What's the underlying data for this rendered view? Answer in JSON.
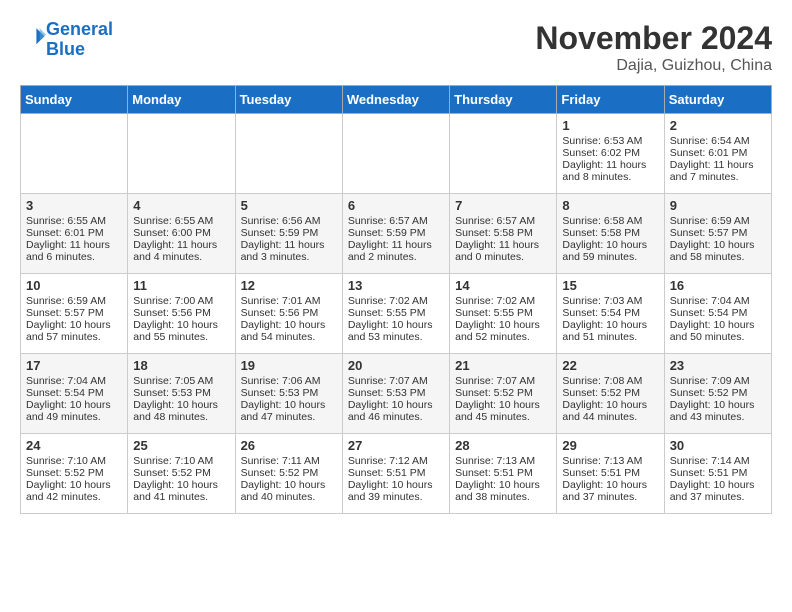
{
  "header": {
    "logo_line1": "General",
    "logo_line2": "Blue",
    "month_title": "November 2024",
    "location": "Dajia, Guizhou, China"
  },
  "days_of_week": [
    "Sunday",
    "Monday",
    "Tuesday",
    "Wednesday",
    "Thursday",
    "Friday",
    "Saturday"
  ],
  "weeks": [
    [
      {
        "day": "",
        "content": ""
      },
      {
        "day": "",
        "content": ""
      },
      {
        "day": "",
        "content": ""
      },
      {
        "day": "",
        "content": ""
      },
      {
        "day": "",
        "content": ""
      },
      {
        "day": "1",
        "content": "Sunrise: 6:53 AM\nSunset: 6:02 PM\nDaylight: 11 hours and 8 minutes."
      },
      {
        "day": "2",
        "content": "Sunrise: 6:54 AM\nSunset: 6:01 PM\nDaylight: 11 hours and 7 minutes."
      }
    ],
    [
      {
        "day": "3",
        "content": "Sunrise: 6:55 AM\nSunset: 6:01 PM\nDaylight: 11 hours and 6 minutes."
      },
      {
        "day": "4",
        "content": "Sunrise: 6:55 AM\nSunset: 6:00 PM\nDaylight: 11 hours and 4 minutes."
      },
      {
        "day": "5",
        "content": "Sunrise: 6:56 AM\nSunset: 5:59 PM\nDaylight: 11 hours and 3 minutes."
      },
      {
        "day": "6",
        "content": "Sunrise: 6:57 AM\nSunset: 5:59 PM\nDaylight: 11 hours and 2 minutes."
      },
      {
        "day": "7",
        "content": "Sunrise: 6:57 AM\nSunset: 5:58 PM\nDaylight: 11 hours and 0 minutes."
      },
      {
        "day": "8",
        "content": "Sunrise: 6:58 AM\nSunset: 5:58 PM\nDaylight: 10 hours and 59 minutes."
      },
      {
        "day": "9",
        "content": "Sunrise: 6:59 AM\nSunset: 5:57 PM\nDaylight: 10 hours and 58 minutes."
      }
    ],
    [
      {
        "day": "10",
        "content": "Sunrise: 6:59 AM\nSunset: 5:57 PM\nDaylight: 10 hours and 57 minutes."
      },
      {
        "day": "11",
        "content": "Sunrise: 7:00 AM\nSunset: 5:56 PM\nDaylight: 10 hours and 55 minutes."
      },
      {
        "day": "12",
        "content": "Sunrise: 7:01 AM\nSunset: 5:56 PM\nDaylight: 10 hours and 54 minutes."
      },
      {
        "day": "13",
        "content": "Sunrise: 7:02 AM\nSunset: 5:55 PM\nDaylight: 10 hours and 53 minutes."
      },
      {
        "day": "14",
        "content": "Sunrise: 7:02 AM\nSunset: 5:55 PM\nDaylight: 10 hours and 52 minutes."
      },
      {
        "day": "15",
        "content": "Sunrise: 7:03 AM\nSunset: 5:54 PM\nDaylight: 10 hours and 51 minutes."
      },
      {
        "day": "16",
        "content": "Sunrise: 7:04 AM\nSunset: 5:54 PM\nDaylight: 10 hours and 50 minutes."
      }
    ],
    [
      {
        "day": "17",
        "content": "Sunrise: 7:04 AM\nSunset: 5:54 PM\nDaylight: 10 hours and 49 minutes."
      },
      {
        "day": "18",
        "content": "Sunrise: 7:05 AM\nSunset: 5:53 PM\nDaylight: 10 hours and 48 minutes."
      },
      {
        "day": "19",
        "content": "Sunrise: 7:06 AM\nSunset: 5:53 PM\nDaylight: 10 hours and 47 minutes."
      },
      {
        "day": "20",
        "content": "Sunrise: 7:07 AM\nSunset: 5:53 PM\nDaylight: 10 hours and 46 minutes."
      },
      {
        "day": "21",
        "content": "Sunrise: 7:07 AM\nSunset: 5:52 PM\nDaylight: 10 hours and 45 minutes."
      },
      {
        "day": "22",
        "content": "Sunrise: 7:08 AM\nSunset: 5:52 PM\nDaylight: 10 hours and 44 minutes."
      },
      {
        "day": "23",
        "content": "Sunrise: 7:09 AM\nSunset: 5:52 PM\nDaylight: 10 hours and 43 minutes."
      }
    ],
    [
      {
        "day": "24",
        "content": "Sunrise: 7:10 AM\nSunset: 5:52 PM\nDaylight: 10 hours and 42 minutes."
      },
      {
        "day": "25",
        "content": "Sunrise: 7:10 AM\nSunset: 5:52 PM\nDaylight: 10 hours and 41 minutes."
      },
      {
        "day": "26",
        "content": "Sunrise: 7:11 AM\nSunset: 5:52 PM\nDaylight: 10 hours and 40 minutes."
      },
      {
        "day": "27",
        "content": "Sunrise: 7:12 AM\nSunset: 5:51 PM\nDaylight: 10 hours and 39 minutes."
      },
      {
        "day": "28",
        "content": "Sunrise: 7:13 AM\nSunset: 5:51 PM\nDaylight: 10 hours and 38 minutes."
      },
      {
        "day": "29",
        "content": "Sunrise: 7:13 AM\nSunset: 5:51 PM\nDaylight: 10 hours and 37 minutes."
      },
      {
        "day": "30",
        "content": "Sunrise: 7:14 AM\nSunset: 5:51 PM\nDaylight: 10 hours and 37 minutes."
      }
    ]
  ]
}
